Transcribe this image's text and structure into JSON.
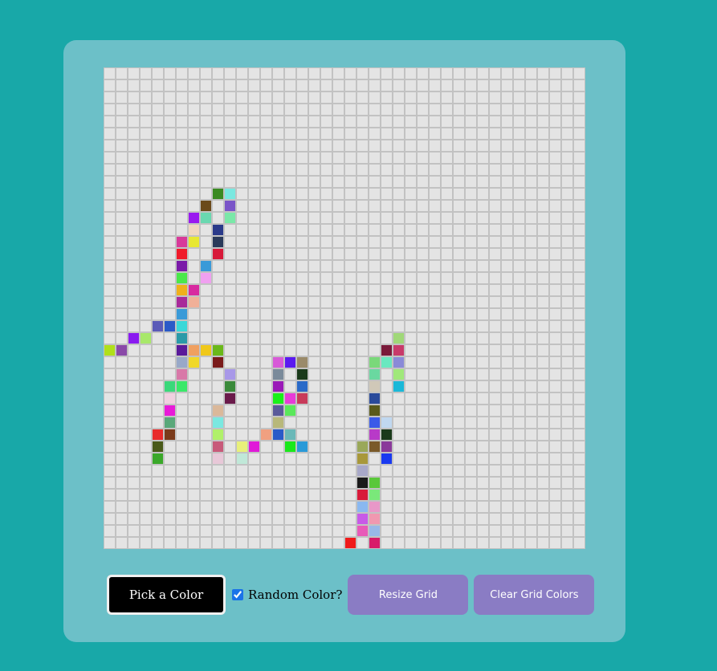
{
  "controls": {
    "pick_color_label": "Pick a Color",
    "random_color_label": "Random Color?",
    "random_color_checked": true,
    "resize_label": "Resize Grid",
    "clear_label": "Clear Grid Colors"
  },
  "grid": {
    "columns": 40,
    "rows": 40,
    "empty_color": "#e4e4e4",
    "line_color": "#c2c2c2",
    "colored_cells": [
      [
        9,
        0,
        "#3a8a22"
      ],
      [
        10,
        0,
        "#7ae8e0"
      ],
      [
        8,
        1,
        "#6b4a1a"
      ],
      [
        10,
        1,
        "#7a55c8"
      ],
      [
        7,
        2,
        "#9a1af0"
      ],
      [
        8,
        2,
        "#6ad8b0"
      ],
      [
        10,
        2,
        "#7ae8a8"
      ],
      [
        7,
        3,
        "#f0d8c0"
      ],
      [
        9,
        3,
        "#2a3a8a"
      ],
      [
        6,
        4,
        "#d83a9a"
      ],
      [
        7,
        4,
        "#e8e832"
      ],
      [
        9,
        4,
        "#2a3a5a"
      ],
      [
        6,
        5,
        "#f01a2a"
      ],
      [
        9,
        5,
        "#d81a3a"
      ],
      [
        6,
        6,
        "#7a1aa8"
      ],
      [
        8,
        6,
        "#3a9ad8"
      ],
      [
        6,
        7,
        "#4ae84a"
      ],
      [
        8,
        7,
        "#f0a0f0"
      ],
      [
        6,
        8,
        "#f0b01a"
      ],
      [
        7,
        8,
        "#d82aa0"
      ],
      [
        6,
        9,
        "#a82a9a"
      ],
      [
        7,
        9,
        "#f0b098"
      ],
      [
        6,
        10,
        "#3a9ad8"
      ],
      [
        4,
        11,
        "#5a5ab8"
      ],
      [
        5,
        11,
        "#2a5ac8"
      ],
      [
        6,
        11,
        "#3ad8d8"
      ],
      [
        2,
        12,
        "#8a1af0"
      ],
      [
        3,
        12,
        "#a8e86a"
      ],
      [
        6,
        12,
        "#2a9aa8"
      ],
      [
        0,
        13,
        "#b0e01a"
      ],
      [
        1,
        13,
        "#8a4aa8"
      ],
      [
        6,
        13,
        "#5a1a9a"
      ],
      [
        7,
        13,
        "#f0a060"
      ],
      [
        8,
        13,
        "#f0c81a"
      ],
      [
        9,
        13,
        "#6ab81a"
      ],
      [
        6,
        14,
        "#98a8c8"
      ],
      [
        7,
        14,
        "#f0d82a"
      ],
      [
        9,
        14,
        "#7a1a1a"
      ],
      [
        6,
        15,
        "#d878a8"
      ],
      [
        10,
        15,
        "#a898e8"
      ],
      [
        5,
        16,
        "#3ad87a"
      ],
      [
        6,
        16,
        "#3ae86a"
      ],
      [
        10,
        16,
        "#3a8a3a"
      ],
      [
        5,
        17,
        "#f0d0e0"
      ],
      [
        10,
        17,
        "#6a1a4a"
      ],
      [
        5,
        18,
        "#e81ad8"
      ],
      [
        9,
        18,
        "#dab89a"
      ],
      [
        5,
        19,
        "#5aa87a"
      ],
      [
        9,
        19,
        "#7ae8e0"
      ],
      [
        4,
        20,
        "#e82a2a"
      ],
      [
        5,
        20,
        "#7a3a1a"
      ],
      [
        9,
        20,
        "#b0f06a"
      ],
      [
        4,
        21,
        "#4a5a1a"
      ],
      [
        9,
        21,
        "#c85a7a"
      ],
      [
        4,
        22,
        "#3aa82a"
      ],
      [
        9,
        22,
        "#e8c8d8"
      ],
      [
        14,
        14,
        "#d85ad8"
      ],
      [
        15,
        14,
        "#5a1af0"
      ],
      [
        16,
        14,
        "#9a8a6a"
      ],
      [
        14,
        15,
        "#7a8a9a"
      ],
      [
        16,
        15,
        "#1a3a1a"
      ],
      [
        14,
        16,
        "#9a1ab8"
      ],
      [
        16,
        16,
        "#2a6ac8"
      ],
      [
        14,
        17,
        "#1af01a"
      ],
      [
        15,
        17,
        "#e83ad8"
      ],
      [
        16,
        17,
        "#c83a5a"
      ],
      [
        14,
        18,
        "#5a5a9a"
      ],
      [
        15,
        18,
        "#5ae85a"
      ],
      [
        14,
        19,
        "#b8b87a"
      ],
      [
        13,
        20,
        "#f0a080"
      ],
      [
        14,
        20,
        "#2a5ac8"
      ],
      [
        15,
        20,
        "#6ab8b8"
      ],
      [
        11,
        21,
        "#e8f07a"
      ],
      [
        12,
        21,
        "#e01ad8"
      ],
      [
        15,
        21,
        "#1ae81a"
      ],
      [
        16,
        21,
        "#2a9ad8"
      ],
      [
        11,
        22,
        "#c0e8d8"
      ],
      [
        24,
        12,
        "#a0d878"
      ],
      [
        23,
        13,
        "#7a1a3a"
      ],
      [
        24,
        13,
        "#c83a6a"
      ],
      [
        22,
        14,
        "#7ad87a"
      ],
      [
        23,
        14,
        "#6ae8c0"
      ],
      [
        24,
        14,
        "#8a8ad8"
      ],
      [
        22,
        15,
        "#6ad8a0"
      ],
      [
        24,
        15,
        "#a0e87a"
      ],
      [
        22,
        16,
        "#d0c8b8"
      ],
      [
        24,
        16,
        "#1ab8d8"
      ],
      [
        22,
        17,
        "#2a4a9a"
      ],
      [
        22,
        18,
        "#5a5a1a"
      ],
      [
        22,
        19,
        "#3a5ae8"
      ],
      [
        23,
        19,
        "#c0d8f0"
      ],
      [
        22,
        20,
        "#b83ac8"
      ],
      [
        23,
        20,
        "#1a3a1a"
      ],
      [
        21,
        21,
        "#9aa85a"
      ],
      [
        22,
        21,
        "#7a5a2a"
      ],
      [
        23,
        21,
        "#8a3a9a"
      ],
      [
        21,
        22,
        "#a8983a"
      ],
      [
        23,
        22,
        "#1a3af0"
      ],
      [
        21,
        23,
        "#a8a8c8"
      ],
      [
        21,
        24,
        "#1a1a1a"
      ],
      [
        22,
        24,
        "#5ac83a"
      ],
      [
        21,
        25,
        "#d81a3a"
      ],
      [
        22,
        25,
        "#7ae87a"
      ],
      [
        21,
        26,
        "#8ab8f0"
      ],
      [
        22,
        26,
        "#e898c8"
      ],
      [
        21,
        27,
        "#c85ae8"
      ],
      [
        22,
        27,
        "#f098b0"
      ],
      [
        21,
        28,
        "#e85ab8"
      ],
      [
        22,
        28,
        "#98b8e8"
      ],
      [
        20,
        29,
        "#f01a1a"
      ],
      [
        22,
        29,
        "#d81a6a"
      ],
      [
        18,
        30,
        "#b83ab8"
      ],
      [
        19,
        30,
        "#e81a8a"
      ],
      [
        22,
        30,
        "#5a3a1a"
      ],
      [
        22,
        31,
        "#c0e0f0"
      ],
      [
        23,
        31,
        "#2a8a2a"
      ],
      [
        24,
        32,
        "#f0a050"
      ]
    ]
  }
}
